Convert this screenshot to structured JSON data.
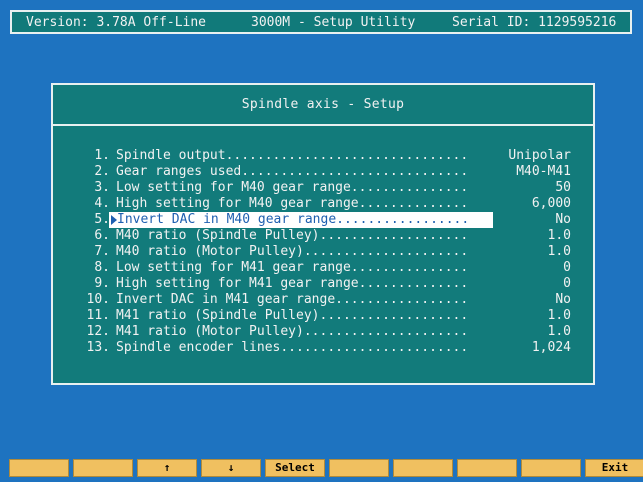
{
  "header": {
    "version": "Version: 3.78A Off-Line",
    "title": "3000M - Setup Utility",
    "serial": "Serial ID: 1129595216"
  },
  "dialog": {
    "title": "Spindle axis - Setup",
    "selected_index": 4,
    "items": [
      {
        "num": "1.",
        "label": "Spindle output...............................",
        "value": "Unipolar"
      },
      {
        "num": "2.",
        "label": "Gear ranges used.............................",
        "value": "M40-M41"
      },
      {
        "num": "3.",
        "label": "Low setting for M40 gear range...............",
        "value": "50"
      },
      {
        "num": "4.",
        "label": "High setting for M40 gear range..............",
        "value": "6,000"
      },
      {
        "num": "5.",
        "label": "Invert DAC in M40 gear range.................",
        "value": "No"
      },
      {
        "num": "6.",
        "label": "M40 ratio (Spindle Pulley)...................",
        "value": "1.0"
      },
      {
        "num": "7.",
        "label": "M40 ratio (Motor Pulley).....................",
        "value": "1.0"
      },
      {
        "num": "8.",
        "label": "Low setting for M41 gear range...............",
        "value": "0"
      },
      {
        "num": "9.",
        "label": "High setting for M41 gear range..............",
        "value": "0"
      },
      {
        "num": "10.",
        "label": "Invert DAC in M41 gear range.................",
        "value": "No"
      },
      {
        "num": "11.",
        "label": "M41 ratio (Spindle Pulley)...................",
        "value": "1.0"
      },
      {
        "num": "12.",
        "label": "M41 ratio (Motor Pulley).....................",
        "value": "1.0"
      },
      {
        "num": "13.",
        "label": "Spindle encoder lines........................",
        "value": "1,024"
      }
    ]
  },
  "fkeys": [
    "",
    "",
    "↑",
    "↓",
    "Select",
    "",
    "",
    "",
    "",
    "Exit"
  ],
  "colors": {
    "background": "#1e73c0",
    "panel": "#127b7b",
    "fkey": "#f0c060",
    "highlight_bg": "#ffffff",
    "highlight_fg": "#1e5fb0"
  }
}
